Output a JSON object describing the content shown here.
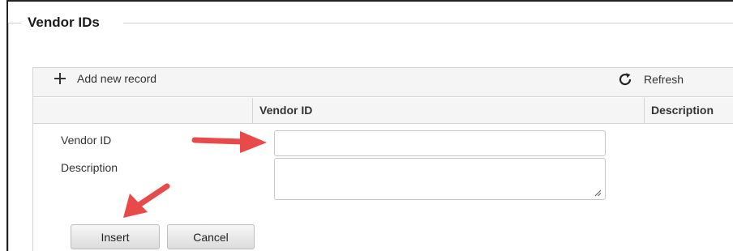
{
  "fieldset": {
    "legend": "Vendor IDs"
  },
  "toolbar": {
    "add_label": "Add new record",
    "refresh_label": "Refresh"
  },
  "grid": {
    "columns": [
      "",
      "Vendor ID",
      "Description"
    ]
  },
  "form": {
    "vendor_id_label": "Vendor ID",
    "description_label": "Description",
    "vendor_id_value": "",
    "description_value": ""
  },
  "buttons": {
    "insert_label": "Insert",
    "cancel_label": "Cancel"
  },
  "colors": {
    "annotation_arrow": "#e84a4a",
    "toolbar_bg": "#f5f5f5",
    "border": "#d3d3d3"
  },
  "icons": {
    "add": "plus-icon",
    "refresh": "refresh-icon"
  }
}
